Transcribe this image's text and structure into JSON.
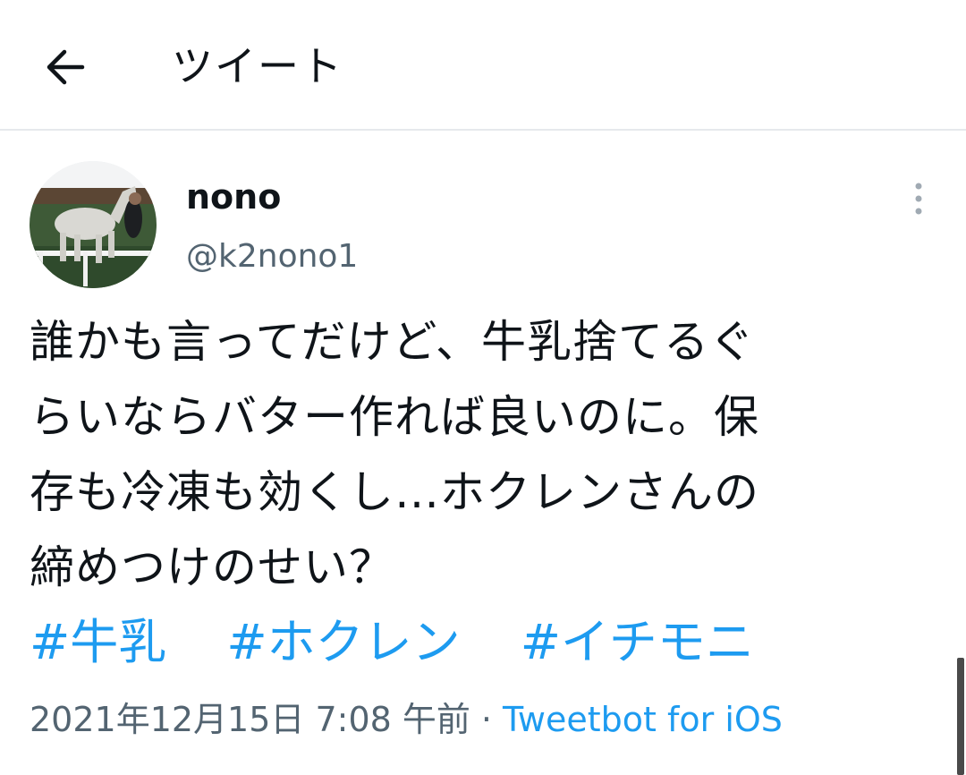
{
  "header": {
    "title": "ツイート",
    "back_icon": "arrow-left-icon"
  },
  "author": {
    "display_name": "nono",
    "handle": "@k2nono1",
    "avatar_alt": "white horse avatar"
  },
  "tweet": {
    "lines": [
      "誰かも言ってだけど、牛乳捨てるぐ",
      "らいならバター作れば良いのに。保",
      "存も冷凍も効くし…ホクレンさんの",
      "締めつけのせい？"
    ],
    "hashtags": [
      "#牛乳",
      "#ホクレン",
      "#イチモニ"
    ]
  },
  "meta": {
    "timestamp": "2021年12月15日 7:08 午前",
    "separator": "·",
    "source": "Tweetbot for iOS"
  },
  "colors": {
    "link": "#1d9bf0",
    "secondary_text": "#536471",
    "divider": "#e6e9ec"
  }
}
